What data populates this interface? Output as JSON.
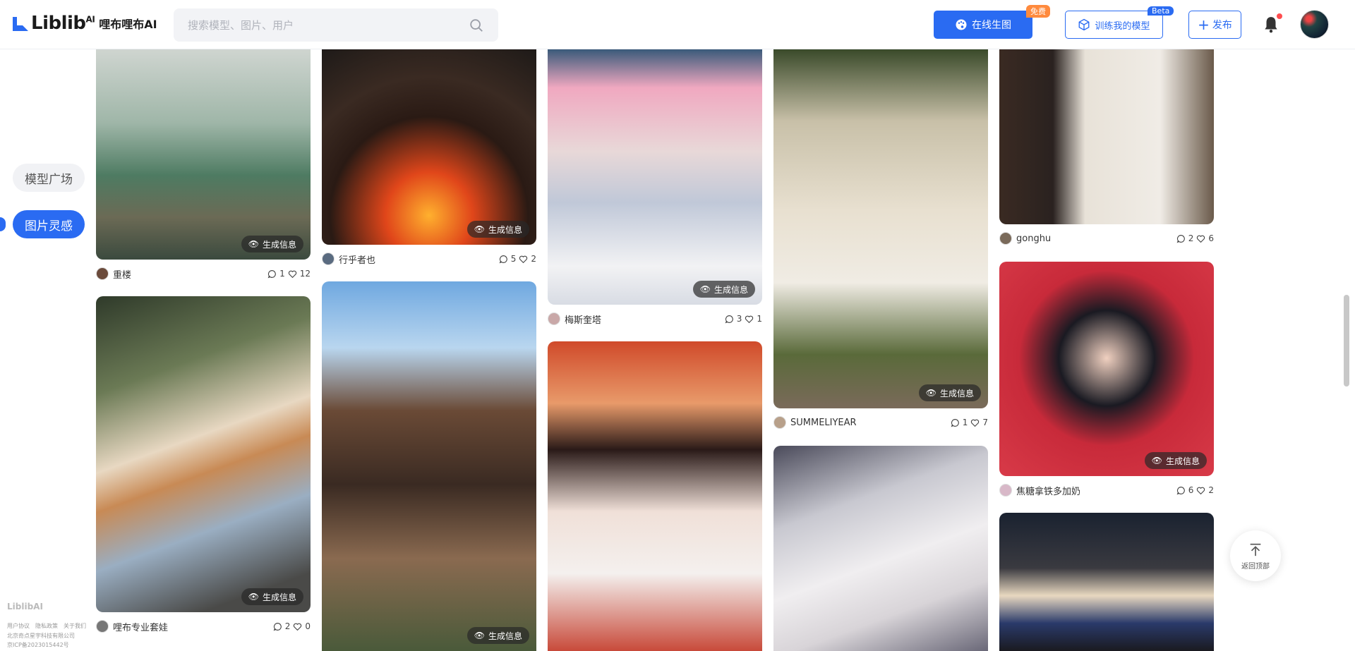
{
  "header": {
    "logo_text": "Liblib",
    "logo_ai": "AI",
    "logo_cn": "哩布哩布AI",
    "search_placeholder": "搜索模型、图片、用户",
    "gen_button": "在线生图",
    "free_tag": "免费",
    "train_button": "训练我的模型",
    "beta_tag": "Beta",
    "publish_button": "发布"
  },
  "sidebar": {
    "items": [
      {
        "label": "模型广场"
      },
      {
        "label": "图片灵感"
      }
    ]
  },
  "footer": {
    "logo": "LiblibAI",
    "links": [
      "用户协议",
      "隐私政策",
      "关于我们"
    ],
    "company": "北京奇点星宇科技有限公司",
    "icp": "京ICP备2023015442号"
  },
  "badge_label": "生成信息",
  "back_top_label": "返回顶部",
  "cards": [
    {
      "user": "重楼",
      "comments": "1",
      "likes": "12"
    },
    {
      "user": "哩布专业套娃",
      "comments": "2",
      "likes": "0"
    },
    {
      "user": "行乎者也",
      "comments": "5",
      "likes": "2"
    },
    {
      "user": "",
      "comments": "",
      "likes": ""
    },
    {
      "user": "梅斯奎塔",
      "comments": "3",
      "likes": "1"
    },
    {
      "user": "",
      "comments": "",
      "likes": ""
    },
    {
      "user": "SUMMELIYEAR",
      "comments": "1",
      "likes": "7"
    },
    {
      "user": "",
      "comments": "",
      "likes": ""
    },
    {
      "user": "gonghu",
      "comments": "2",
      "likes": "6"
    },
    {
      "user": "焦糖拿铁多加奶",
      "comments": "6",
      "likes": "2"
    },
    {
      "user": "",
      "comments": "",
      "likes": ""
    }
  ]
}
